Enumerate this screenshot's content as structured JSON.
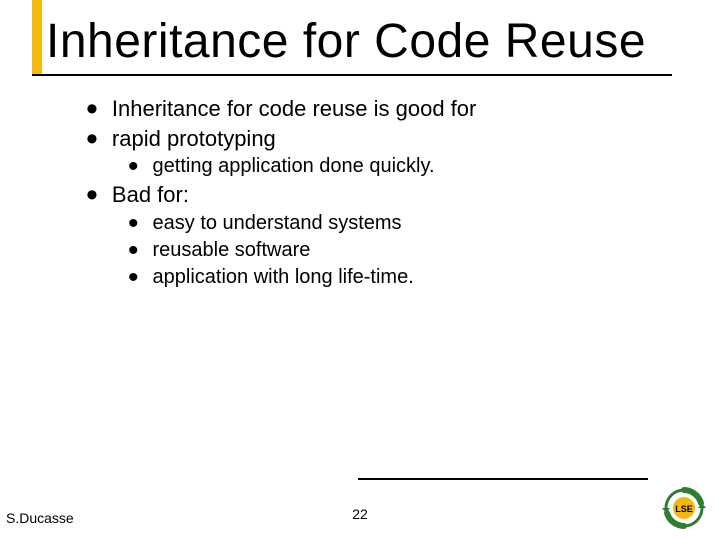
{
  "title": "Inheritance for Code Reuse",
  "bullets": {
    "b1": "Inheritance for code reuse is good for",
    "b2": "rapid prototyping",
    "b2_sub1": "getting application done quickly.",
    "b3": "Bad for:",
    "b3_sub1": "easy to understand systems",
    "b3_sub2": "reusable software",
    "b3_sub3": "application with long life-time."
  },
  "footer": {
    "author": "S.Ducasse",
    "page": "22"
  },
  "logo_label": "LSE"
}
